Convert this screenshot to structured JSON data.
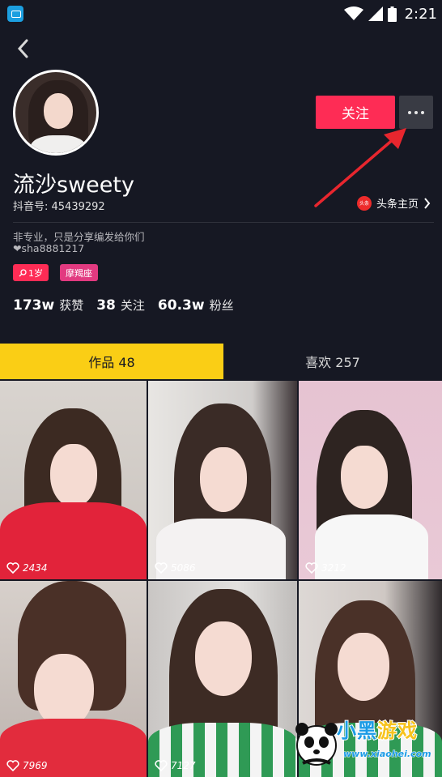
{
  "status_bar": {
    "time": "2:21"
  },
  "profile": {
    "nickname": "流沙sweety",
    "douyin_id": "抖音号: 45439292",
    "follow_label": "关注",
    "toutiao_icon_text": "头条",
    "toutiao_label": "头条主页",
    "bio_line1": "非专业，只是分享编发给你们",
    "bio_line2": "❤sha8881217",
    "tags": {
      "age": "1岁",
      "zodiac": "摩羯座"
    },
    "stats": {
      "likes_count": "173w",
      "likes_label": "获赞",
      "following_count": "38",
      "following_label": "关注",
      "followers_count": "60.3w",
      "followers_label": "粉丝"
    }
  },
  "tabs": {
    "works": "作品 48",
    "likes": "喜欢 257"
  },
  "videos": [
    {
      "likes": "2434"
    },
    {
      "likes": "5086"
    },
    {
      "likes": "3212"
    },
    {
      "likes": "7969"
    },
    {
      "likes": "7127"
    },
    {
      "likes": ""
    }
  ],
  "watermark": {
    "brand_part1": "小黑",
    "brand_part2": "游戏",
    "url": "www.xiaohei.com"
  },
  "colors": {
    "background": "#161823",
    "accent_red": "#fe2c55",
    "tab_yellow": "#face15",
    "zodiac_pink": "#e23a80"
  },
  "icons": {
    "back": "chevron-left-icon",
    "more": "more-dots-icon",
    "heart": "heart-outline-icon",
    "chevron": "chevron-right-icon",
    "search_tag": "search-icon"
  }
}
